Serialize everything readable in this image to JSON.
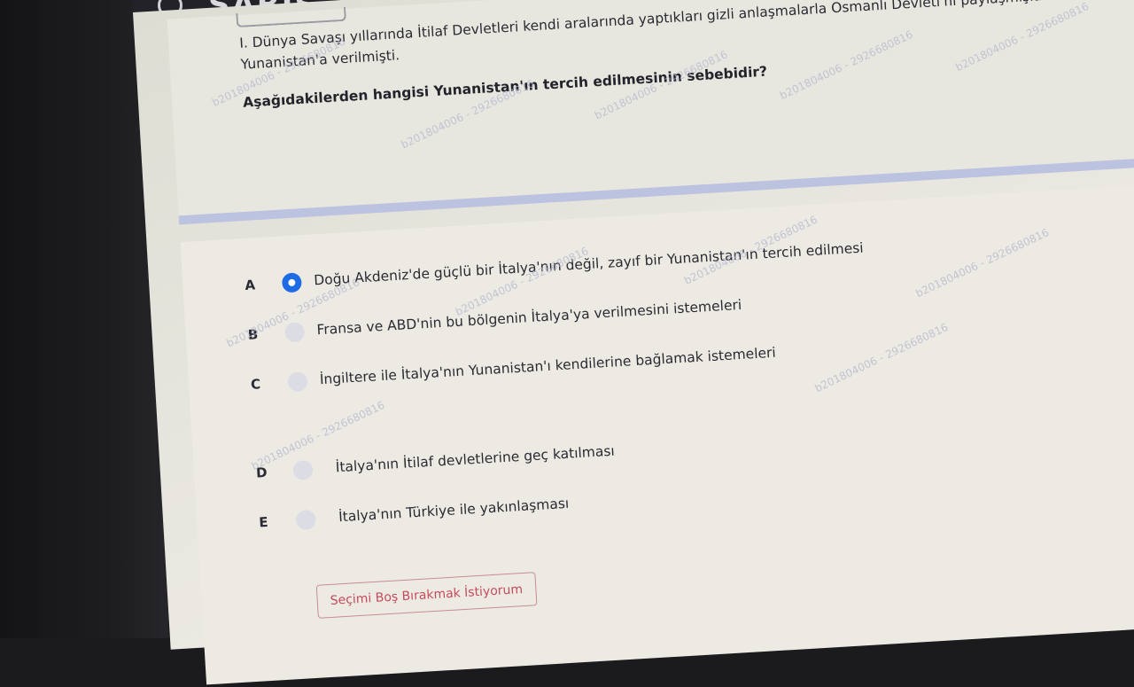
{
  "header": {
    "brand": "SABIS"
  },
  "question": {
    "text_line1": "I. Dünya Savaşı yıllarında İtilaf Devletleri kendi aralarında yaptıkları gizli anlaşmalarla Osmanlı Devleti'ni paylaşmışlar",
    "text_line2": "Yunanistan'a verilmişti.",
    "prompt": "Aşağıdakilerden hangisi Yunanistan'ın tercih edilmesinin sebebidir?"
  },
  "options": [
    {
      "letter": "A",
      "text": "Doğu Akdeniz'de güçlü bir İtalya'nın değil, zayıf bir Yunanistan'ın tercih edilmesi",
      "selected": true
    },
    {
      "letter": "B",
      "text": "Fransa ve ABD'nin bu bölgenin İtalya'ya verilmesini istemeleri",
      "selected": false
    },
    {
      "letter": "C",
      "text": "İngiltere ile İtalya'nın Yunanistan'ı kendilerine bağlamak istemeleri",
      "selected": false
    },
    {
      "letter": "D",
      "text": "İtalya'nın İtilaf devletlerine geç katılması",
      "selected": false
    },
    {
      "letter": "E",
      "text": "İtalya'nın Türkiye ile yakınlaşması",
      "selected": false
    }
  ],
  "skip_button": {
    "label": "Seçimi Boş Bırakmak İstiyorum"
  },
  "watermark": {
    "text": "b201804006 - 2926680816"
  },
  "colors": {
    "accent": "#1e6be6",
    "danger": "#c44c5e",
    "divider": "#bcc3e0"
  }
}
